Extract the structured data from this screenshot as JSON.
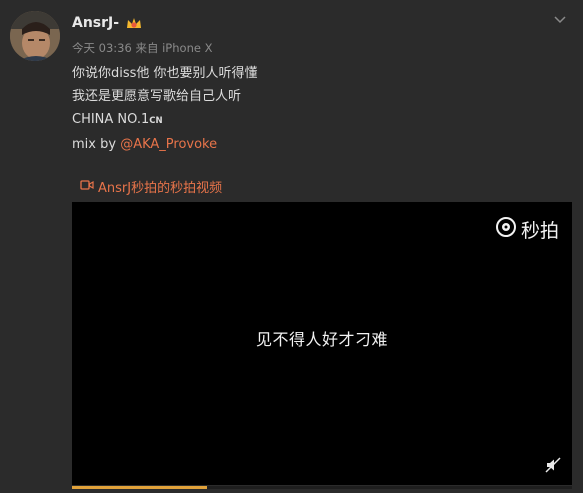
{
  "post": {
    "username": "AnsrJ-",
    "vip_icon": "vip-crown-badge",
    "timestamp": "今天 03:36",
    "source": "来自 iPhone X",
    "lines": [
      "你说你diss他 你也要别人听得懂",
      "我还是更愿意写歌给自己人听"
    ],
    "china_prefix": "CHINA NO.1",
    "china_suffix": "CN",
    "mix_prefix": "mix by ",
    "mention": "@AKA_Provoke"
  },
  "video": {
    "link_label": "AnsrJ秒拍的秒拍视频",
    "logo_text": "秒拍",
    "subtitle": "见不得人好才刁难",
    "progress": 0.27
  },
  "colors": {
    "background": "#2b2b2b",
    "link": "#e8744a",
    "progress": "#e1a23a"
  }
}
